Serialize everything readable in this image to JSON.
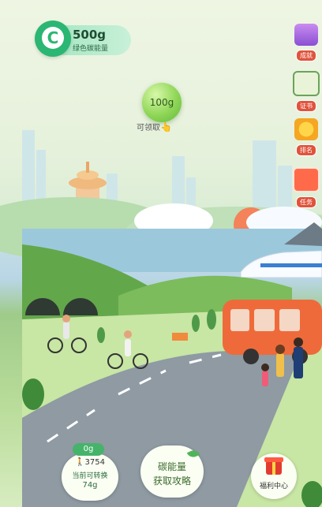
{
  "balance": {
    "amount": "500g",
    "label": "绿色碳能量"
  },
  "bubble": {
    "amount": "100g",
    "claim_label": "可领取",
    "claim_icon": "👆"
  },
  "side_menu": [
    {
      "label": "成就",
      "icon": "trophy-icon"
    },
    {
      "label": "证书",
      "icon": "certificate-icon"
    },
    {
      "label": "排名",
      "icon": "medal-icon"
    },
    {
      "label": "任务",
      "icon": "calendar-icon"
    }
  ],
  "steps": {
    "chip": "0g",
    "walker_icon": "🚶",
    "count": "3754",
    "convert_label": "当前可转换",
    "convert_value": "74g"
  },
  "guide": {
    "line1": "碳能量",
    "line2": "获取攻略"
  },
  "welfare": {
    "label": "福利中心"
  }
}
